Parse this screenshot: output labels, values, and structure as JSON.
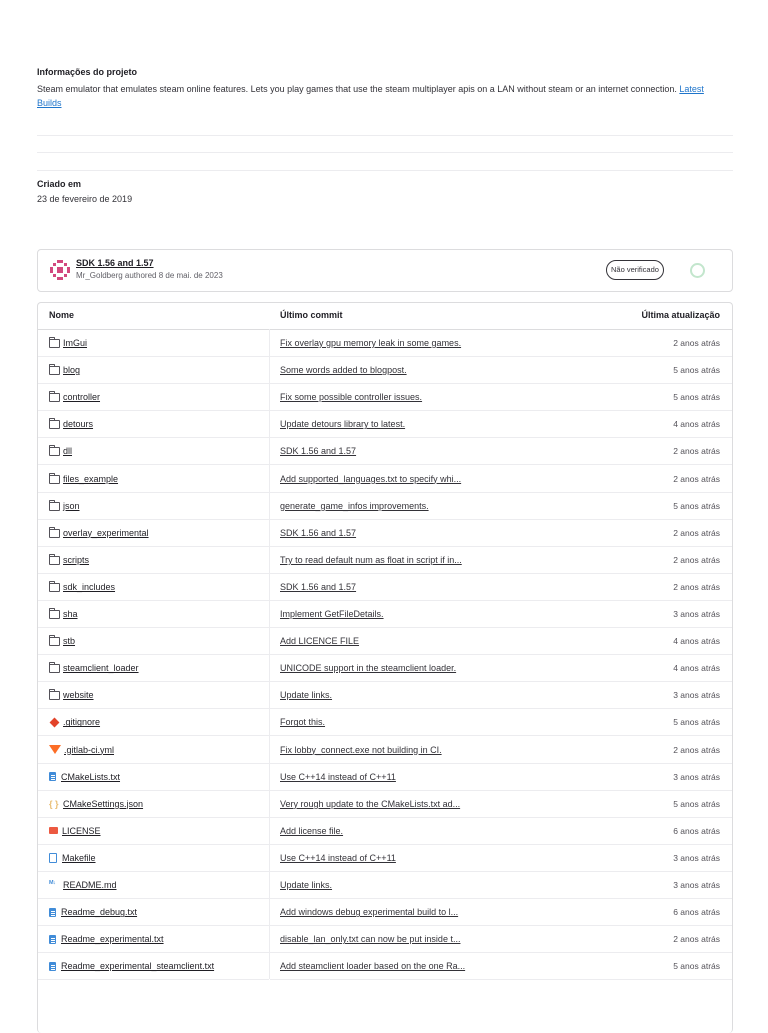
{
  "project_info": {
    "title": "Informações do projeto",
    "description": "Steam emulator that emulates steam online features. Lets you play games that use the steam multiplayer apis on a LAN without steam or an internet connection.",
    "link_label": "Latest Builds"
  },
  "created": {
    "title": "Criado em",
    "date": "23 de fevereiro de 2019"
  },
  "last_commit": {
    "title": "SDK 1.56 and 1.57",
    "meta": "Mr_Goldberg authored 8 de mai. de 2023",
    "badge": "Não verificado",
    "pipeline_color": "#c3e6cd"
  },
  "table": {
    "headers": {
      "name": "Nome",
      "commit": "Último commit",
      "updated": "Última atualização"
    },
    "rows": [
      {
        "name": "ImGui",
        "icon": "folder-icon",
        "commit": "Fix overlay gpu memory leak in some games.",
        "updated": "2 anos atrás"
      },
      {
        "name": "blog",
        "icon": "folder-icon",
        "commit": "Some words added to blogpost.",
        "updated": "5 anos atrás"
      },
      {
        "name": "controller",
        "icon": "folder-icon",
        "commit": "Fix some possible controller issues.",
        "updated": "5 anos atrás"
      },
      {
        "name": "detours",
        "icon": "folder-icon",
        "commit": "Update detours library to latest.",
        "updated": "4 anos atrás"
      },
      {
        "name": "dll",
        "icon": "folder-icon",
        "commit": "SDK 1.56 and 1.57",
        "updated": "2 anos atrás"
      },
      {
        "name": "files_example",
        "icon": "folder-icon",
        "commit": "Add supported_languages.txt to specify whi...",
        "updated": "2 anos atrás"
      },
      {
        "name": "json",
        "icon": "folder-icon",
        "commit": "generate_game_infos improvements.",
        "updated": "5 anos atrás"
      },
      {
        "name": "overlay_experimental",
        "icon": "folder-icon",
        "commit": "SDK 1.56 and 1.57",
        "updated": "2 anos atrás"
      },
      {
        "name": "scripts",
        "icon": "folder-icon",
        "commit": "Try to read default num as float in script if in...",
        "updated": "2 anos atrás"
      },
      {
        "name": "sdk_includes",
        "icon": "folder-icon",
        "commit": "SDK 1.56 and 1.57",
        "updated": "2 anos atrás"
      },
      {
        "name": "sha",
        "icon": "folder-icon",
        "commit": "Implement GetFileDetails.",
        "updated": "3 anos atrás"
      },
      {
        "name": "stb",
        "icon": "folder-icon",
        "commit": "Add LICENCE FILE",
        "updated": "4 anos atrás"
      },
      {
        "name": "steamclient_loader",
        "icon": "folder-icon",
        "commit": "UNICODE support in the steamclient loader.",
        "updated": "4 anos atrás"
      },
      {
        "name": "website",
        "icon": "folder-icon",
        "commit": "Update links.",
        "updated": "3 anos atrás"
      },
      {
        "name": ".gitignore",
        "icon": "git-icon",
        "commit": "Forgot this.",
        "updated": "5 anos atrás"
      },
      {
        "name": ".gitlab-ci.yml",
        "icon": "gitlab-icon",
        "commit": "Fix lobby_connect.exe not building in CI.",
        "updated": "2 anos atrás"
      },
      {
        "name": "CMakeLists.txt",
        "icon": "text-file-icon",
        "commit": "Use C++14 instead of C++11",
        "updated": "3 anos atrás"
      },
      {
        "name": "CMakeSettings.json",
        "icon": "json-file-icon",
        "commit": "Very rough update to the CMakeLists.txt ad...",
        "updated": "5 anos atrás"
      },
      {
        "name": "LICENSE",
        "icon": "license-icon",
        "commit": "Add license file.",
        "updated": "6 anos atrás"
      },
      {
        "name": "Makefile",
        "icon": "file-outline-icon",
        "commit": "Use C++14 instead of C++11",
        "updated": "3 anos atrás"
      },
      {
        "name": "README.md",
        "icon": "markdown-icon",
        "commit": "Update links.",
        "updated": "3 anos atrás"
      },
      {
        "name": "Readme_debug.txt",
        "icon": "text-file-icon",
        "commit": "Add windows debug experimental build to l...",
        "updated": "6 anos atrás"
      },
      {
        "name": "Readme_experimental.txt",
        "icon": "text-file-icon",
        "commit": "disable_lan_only.txt can now be put inside t...",
        "updated": "2 anos atrás"
      },
      {
        "name": "Readme_experimental_steamclient.txt",
        "icon": "text-file-icon",
        "commit": "Add steamclient loader based on the one Ra...",
        "updated": "5 anos atrás"
      }
    ]
  }
}
